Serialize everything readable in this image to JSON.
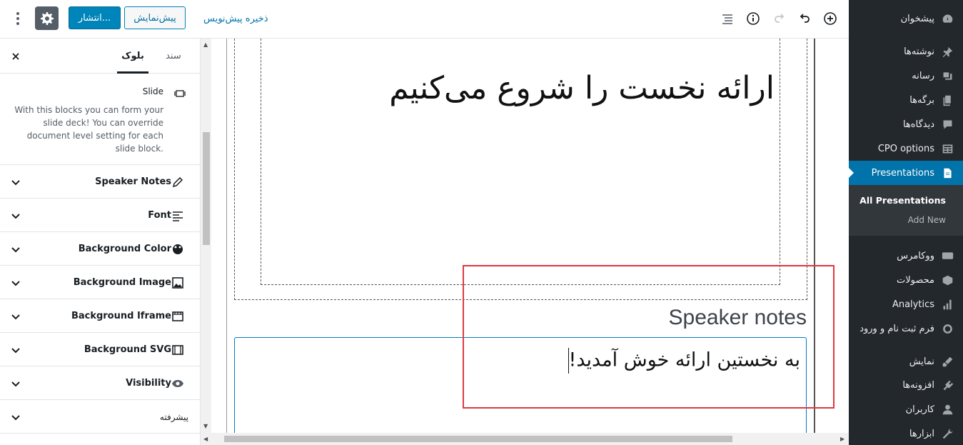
{
  "admin_menu": {
    "items": [
      {
        "label": "پیشخوان",
        "icon": "dashboard-icon"
      },
      {
        "label": "نوشته‌ها",
        "icon": "pin-icon"
      },
      {
        "label": "رسانه",
        "icon": "media-icon"
      },
      {
        "label": "برگه‌ها",
        "icon": "pages-icon"
      },
      {
        "label": "دیدگاه‌ها",
        "icon": "comments-icon"
      },
      {
        "label": "CPO options",
        "icon": "table-icon"
      },
      {
        "label": "Presentations",
        "icon": "document-icon"
      },
      {
        "label": "ووکامرس",
        "icon": "woocommerce-icon"
      },
      {
        "label": "محصولات",
        "icon": "box-icon"
      },
      {
        "label": "Analytics",
        "icon": "chart-icon"
      },
      {
        "label": "فرم ثبت نام و ورود",
        "icon": "circle-icon"
      },
      {
        "label": "نمایش",
        "icon": "brush-icon"
      },
      {
        "label": "افزونه‌ها",
        "icon": "plugin-icon"
      },
      {
        "label": "کاربران",
        "icon": "user-icon"
      },
      {
        "label": "ابزارها",
        "icon": "wrench-icon"
      }
    ],
    "submenu": [
      "All Presentations",
      "Add New"
    ]
  },
  "toolbar": {
    "publish_label": "انتشار...",
    "preview_label": "پیش‌نمایش",
    "save_draft_label": "ذخیره پیش‌نویس"
  },
  "panel": {
    "tab_block": "بلوک",
    "tab_document": "سند",
    "block_name": "Slide",
    "block_description": "With this blocks you can form your slide deck! You can override document level setting for each slide block.",
    "sections": [
      {
        "label": "Speaker Notes",
        "icon": "pencil-icon"
      },
      {
        "label": "Font",
        "icon": "text-lines-icon"
      },
      {
        "label": "Background Color",
        "icon": "palette-icon"
      },
      {
        "label": "Background Image",
        "icon": "image-icon"
      },
      {
        "label": "Background Iframe",
        "icon": "film-icon"
      },
      {
        "label": "Background SVG",
        "icon": "film-icon"
      },
      {
        "label": "Visibility",
        "icon": "eye-icon"
      },
      {
        "label": "پیشرفته",
        "icon": ""
      }
    ]
  },
  "editor": {
    "slide_heading": "ارائه نخست را شروع می‌کنیم",
    "notes_title": "Speaker notes",
    "notes_text": "به نخستین ارائه خوش آمدید!"
  },
  "colors": {
    "admin_bg": "#23282d",
    "accent": "#0073aa",
    "highlight": "#e0393e"
  }
}
